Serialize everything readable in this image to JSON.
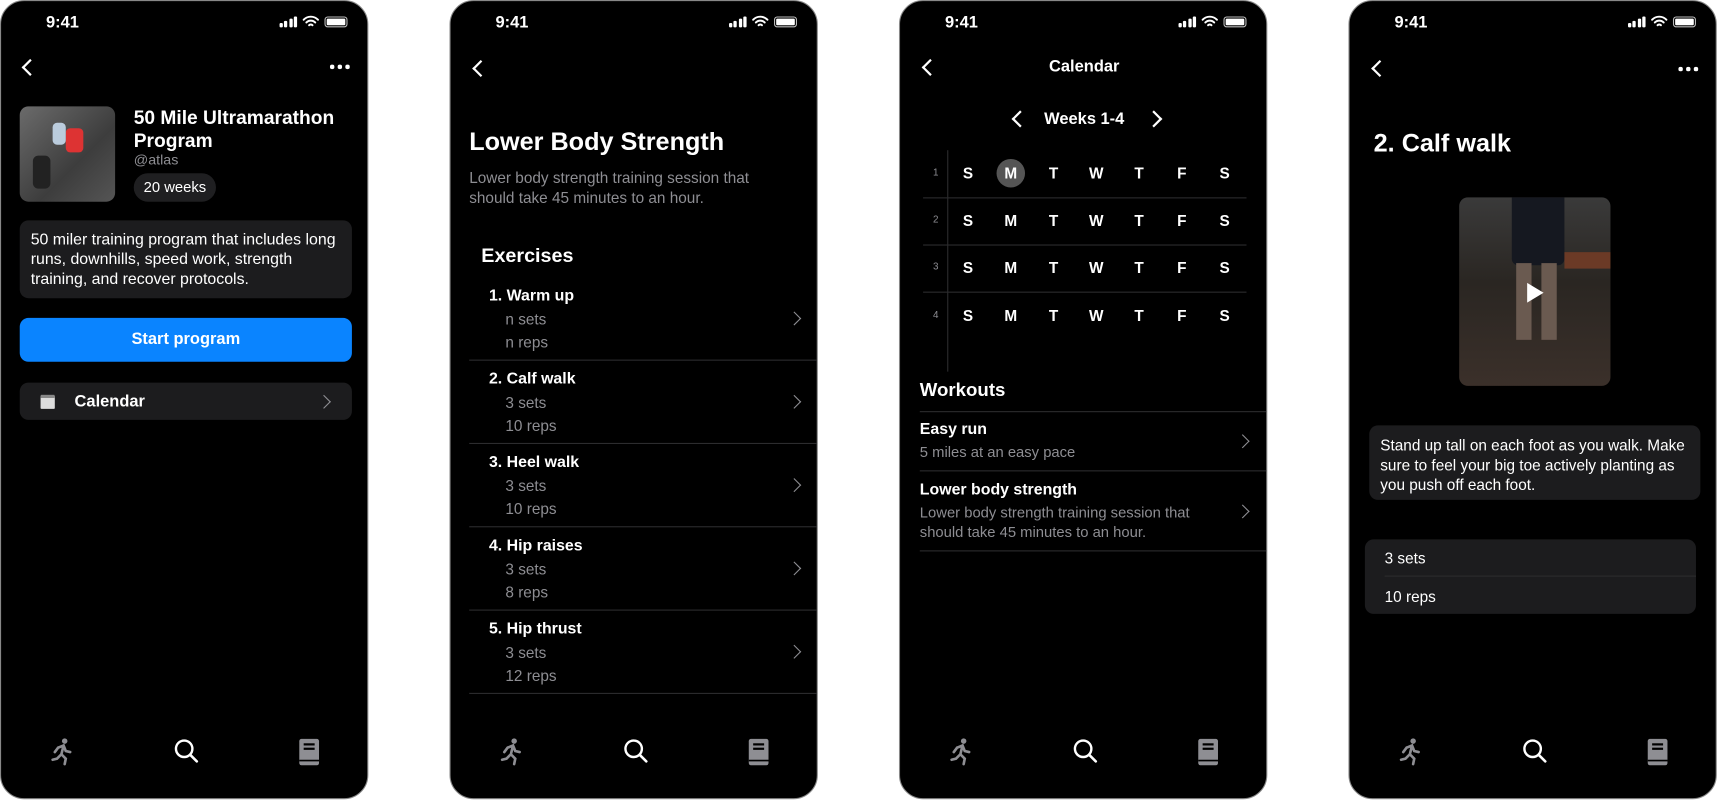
{
  "status_bar": {
    "time": "9:41"
  },
  "screen1": {
    "title": "50 Mile Ultramarathon Program",
    "author": "@atlas",
    "duration": "20 weeks",
    "description": "50 miler training program that includes long runs, downhills, speed work, strength training, and recover protocols.",
    "start_button": "Start program",
    "calendar_label": "Calendar"
  },
  "screen2": {
    "title": "Lower Body Strength",
    "subtitle": "Lower body strength training session that should take 45 minutes to an hour.",
    "section": "Exercises",
    "exercises": [
      {
        "name": "1. Warm up",
        "sets": "n sets",
        "reps": "n reps"
      },
      {
        "name": "2. Calf walk",
        "sets": "3 sets",
        "reps": "10 reps"
      },
      {
        "name": "3. Heel walk",
        "sets": "3 sets",
        "reps": "10 reps"
      },
      {
        "name": "4. Hip raises",
        "sets": "3 sets",
        "reps": "8 reps"
      },
      {
        "name": "5. Hip thrust",
        "sets": "3 sets",
        "reps": "12 reps"
      }
    ]
  },
  "screen3": {
    "title": "Calendar",
    "range": "Weeks 1-4",
    "weeks": [
      "1",
      "2",
      "3",
      "4"
    ],
    "days": [
      "S",
      "M",
      "T",
      "W",
      "T",
      "F",
      "S"
    ],
    "selected": {
      "week": 1,
      "day": "M"
    },
    "section": "Workouts",
    "workouts": [
      {
        "name": "Easy run",
        "desc": "5 miles at an easy pace"
      },
      {
        "name": "Lower body strength",
        "desc": "Lower body strength training session that should take 45 minutes to an hour."
      }
    ]
  },
  "screen4": {
    "title": "2. Calf walk",
    "instructions": "Stand up tall on each foot as you walk. Make sure to feel your big toe actively planting as you push off each foot.",
    "sets": "3 sets",
    "reps": "10 reps"
  },
  "tab_bar": {
    "icons": [
      "running-icon",
      "search-icon",
      "book-icon"
    ],
    "active": "search-icon"
  },
  "colors": {
    "accent": "#0A84FF",
    "background": "#000000",
    "card": "#1C1C1E"
  }
}
